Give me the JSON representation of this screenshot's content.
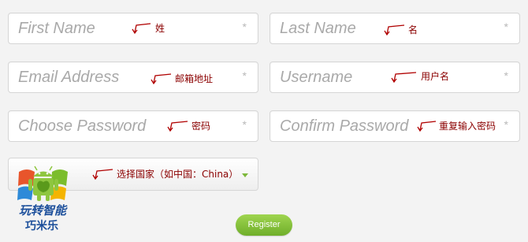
{
  "form": {
    "first_name": {
      "placeholder": "First Name",
      "annotation": "姓"
    },
    "last_name": {
      "placeholder": "Last Name",
      "annotation": "名"
    },
    "email": {
      "placeholder": "Email Address",
      "annotation": "邮箱地址"
    },
    "username": {
      "placeholder": "Username",
      "annotation": "用户名"
    },
    "password": {
      "placeholder": "Choose Password",
      "annotation": "密码"
    },
    "confirm_password": {
      "placeholder": "Confirm Password",
      "annotation": "重复输入密码"
    },
    "country": {
      "annotation": "选择国家（如中国：China）"
    },
    "required_marker": "*",
    "register_label": "Register"
  },
  "logo": {
    "line1": "玩转智能",
    "line2": "巧米乐"
  },
  "colors": {
    "annotation": "#8b0000",
    "accent": "#7cb83a",
    "brand_text": "#1c4f9b"
  },
  "icons": {
    "arrow": "arrow-left-icon",
    "caret": "caret-down-icon",
    "logo": "android-windows-logo"
  }
}
